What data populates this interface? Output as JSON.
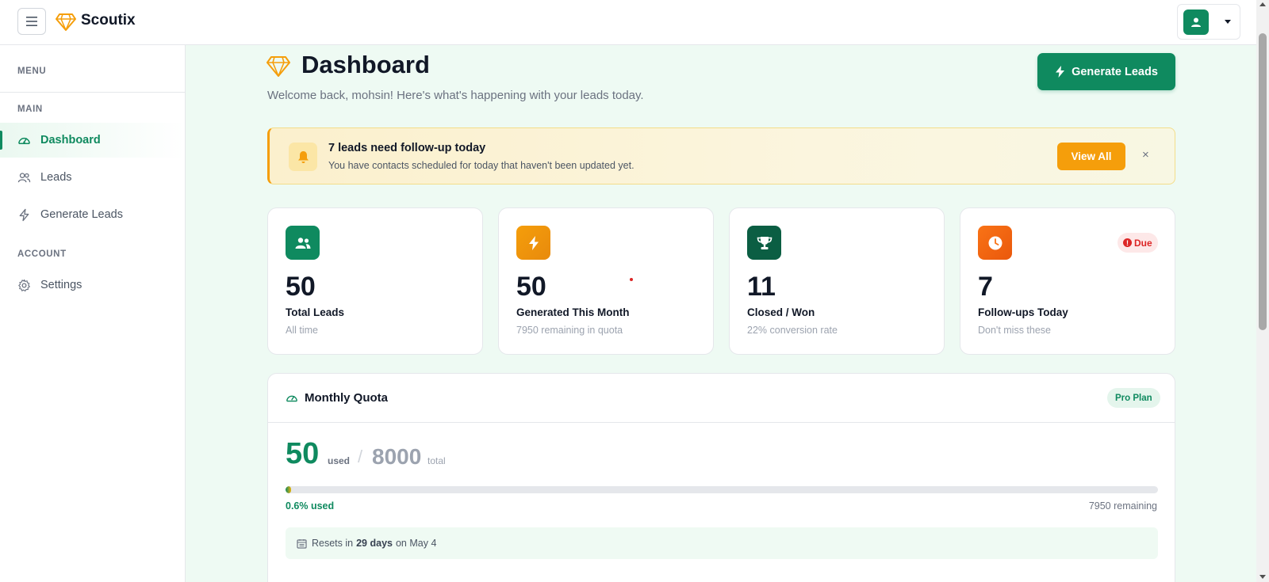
{
  "app": {
    "name": "Scoutix"
  },
  "sidebar": {
    "menu_label": "MENU",
    "main_label": "MAIN",
    "account_label": "ACCOUNT",
    "items": [
      {
        "label": "Dashboard",
        "icon": "dashboard-gauge-icon",
        "active": true
      },
      {
        "label": "Leads",
        "icon": "users-icon"
      },
      {
        "label": "Generate Leads",
        "icon": "bolt-icon"
      },
      {
        "label": "Settings",
        "icon": "gear-icon"
      }
    ]
  },
  "header": {
    "title": "Dashboard",
    "subtitle": "Welcome back, mohsin! Here's what's happening with your leads today.",
    "generate_button": "Generate Leads"
  },
  "alert": {
    "title": "7 leads need follow-up today",
    "text": "You have contacts scheduled for today that haven't been updated yet.",
    "button": "View All",
    "close": "×"
  },
  "stats": [
    {
      "value": "50",
      "label": "Total Leads",
      "sub": "All time",
      "color": "#0f8a5f",
      "icon": "users-icon"
    },
    {
      "value": "50",
      "label": "Generated This Month",
      "sub": "7950 remaining in quota",
      "color": "#f59e0b",
      "icon": "bolt-icon"
    },
    {
      "value": "11",
      "label": "Closed / Won",
      "sub": "22% conversion rate",
      "color": "#0b5e43",
      "icon": "trophy-icon"
    },
    {
      "value": "7",
      "label": "Follow-ups Today",
      "sub": "Don't miss these",
      "color": "#f97316",
      "icon": "clock-icon",
      "badge": "Due"
    }
  ],
  "quota": {
    "title": "Monthly Quota",
    "plan": "Pro Plan",
    "used": "50",
    "used_label": "used",
    "total": "8000",
    "total_label": "total",
    "percent_text": "0.6% used",
    "percent": 0.6,
    "remaining_text": "7950 remaining",
    "reset_prefix": "Resets in",
    "reset_days": "29 days",
    "reset_suffix": "on May 4"
  },
  "colors": {
    "brand": "#0f8a5f",
    "warning": "#f59e0b",
    "danger": "#dc2626",
    "background": "#eefaf3"
  }
}
